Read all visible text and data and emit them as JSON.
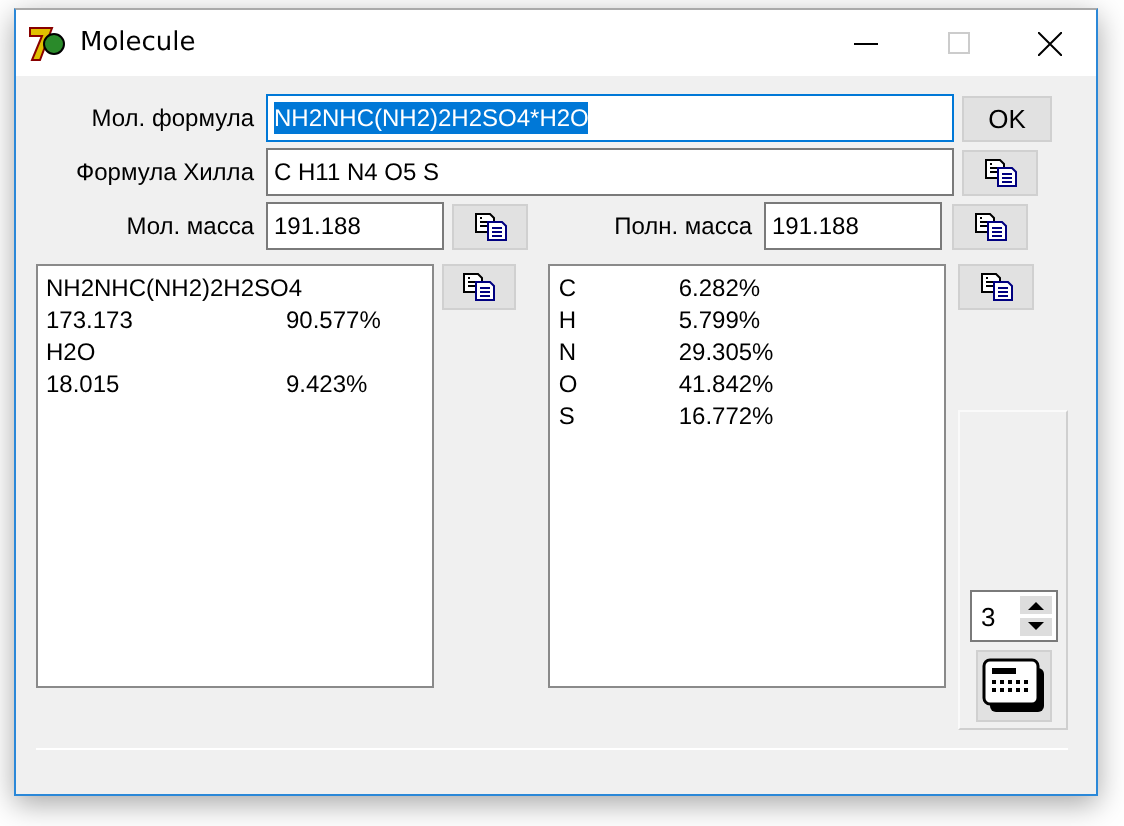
{
  "window": {
    "title": "Molecule"
  },
  "formula": {
    "label": "Мол. формула",
    "value": "NH2NHC(NH2)2H2SO4*H2O",
    "selected": true
  },
  "ok_button": "OK",
  "hill": {
    "label": "Формула Хилла",
    "value": "C H11 N4 O5 S"
  },
  "mol_mass": {
    "label": "Мол. масса",
    "value": "191.188"
  },
  "full_mass": {
    "label": "Полн. масса",
    "value": "191.188"
  },
  "components": [
    {
      "name": "NH2NHC(NH2)2H2SO4",
      "mass": "173.173",
      "percent": "90.577%"
    },
    {
      "name": "H2O",
      "mass": "18.015",
      "percent": "9.423%"
    }
  ],
  "elements": [
    {
      "symbol": "C",
      "percent": "6.282%"
    },
    {
      "symbol": "H",
      "percent": "5.799%"
    },
    {
      "symbol": "N",
      "percent": "29.305%"
    },
    {
      "symbol": "O",
      "percent": "41.842%"
    },
    {
      "symbol": "S",
      "percent": "16.772%"
    }
  ],
  "precision": "3"
}
